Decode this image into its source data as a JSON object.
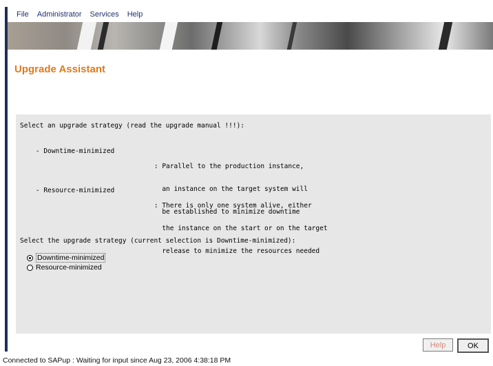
{
  "menu": [
    "File",
    "Administrator",
    "Services",
    "Help"
  ],
  "page_title": "Upgrade Assistant",
  "intro": "Select an upgrade strategy (read the upgrade manual !!!):",
  "options_info": [
    {
      "name": "- Downtime-minimized",
      "desc": [
        ": Parallel to the production instance,",
        "  an instance on the target system will",
        "  be established to minimize downtime"
      ]
    },
    {
      "name": "- Resource-minimized",
      "desc": [
        ": There is only one system alive, either",
        "  the instance on the start or on the target",
        "  release to minimize the resources needed"
      ]
    }
  ],
  "select_prompt": "Select the upgrade strategy (current selection is Downtime-minimized):",
  "radios": [
    {
      "label": "Downtime-minimized",
      "checked": true
    },
    {
      "label": "Resource-minimized",
      "checked": false
    }
  ],
  "buttons": {
    "help": "Help",
    "ok": "OK"
  },
  "status": "Connected to SAPup : Waiting for input since Aug 23, 2006 4:38:18 PM",
  "colors": {
    "title": "#e07a1a",
    "menu_text": "#20306b",
    "panel_bg": "#e7e7e7",
    "frame": "#1f2f55"
  }
}
